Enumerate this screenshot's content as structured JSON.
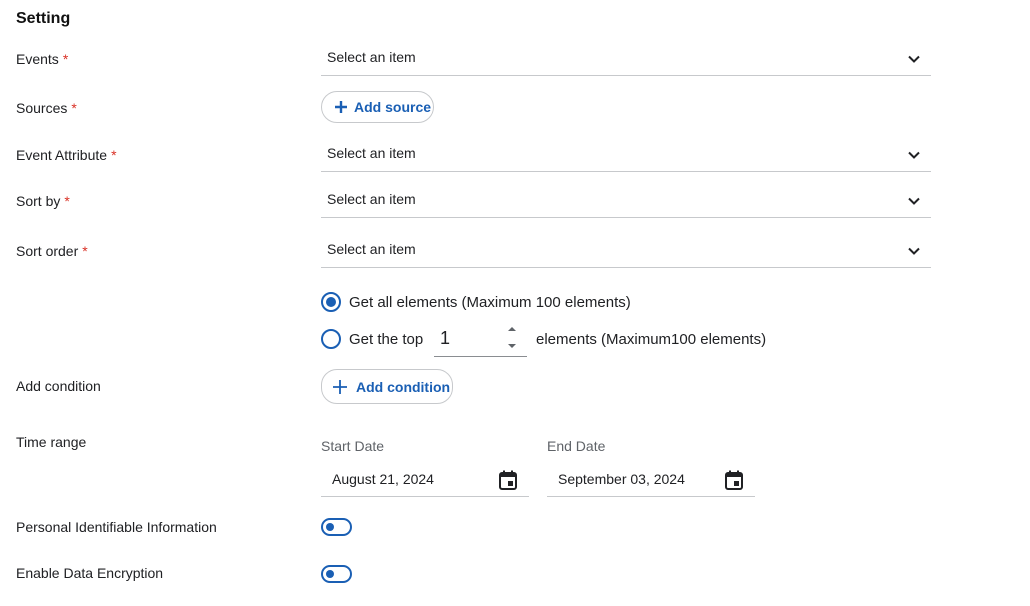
{
  "title": "Setting",
  "labels": {
    "events": "Events",
    "sources": "Sources",
    "event_attribute": "Event Attribute",
    "sort_by": "Sort by",
    "sort_order": "Sort order",
    "add_condition": "Add condition",
    "time_range": "Time range",
    "pii": "Personal Identifiable Information",
    "encryption": "Enable Data Encryption"
  },
  "required_marker": "*",
  "selects": {
    "events": "Select an item",
    "event_attribute": "Select an item",
    "sort_by": "Select an item",
    "sort_order": "Select an item"
  },
  "buttons": {
    "add_source": "Add source",
    "add_condition": "Add condition"
  },
  "elements": {
    "option_all": "Get all elements (Maximum 100 elements)",
    "option_top_prefix": "Get the top",
    "option_top_suffix": "elements (Maximum100 elements)",
    "top_value": "1",
    "selected": "all"
  },
  "time_range": {
    "start_label": "Start Date",
    "start_value": "August 21, 2024",
    "end_label": "End Date",
    "end_value": "September 03, 2024"
  },
  "toggles": {
    "pii": false,
    "encryption": false
  },
  "colors": {
    "accent": "#1a5fb4",
    "required": "#d93025",
    "divider": "#c7c9cc"
  },
  "icons": [
    "chevron-down-icon",
    "plus-icon",
    "calendar-icon",
    "stepper-up-icon",
    "stepper-down-icon"
  ]
}
